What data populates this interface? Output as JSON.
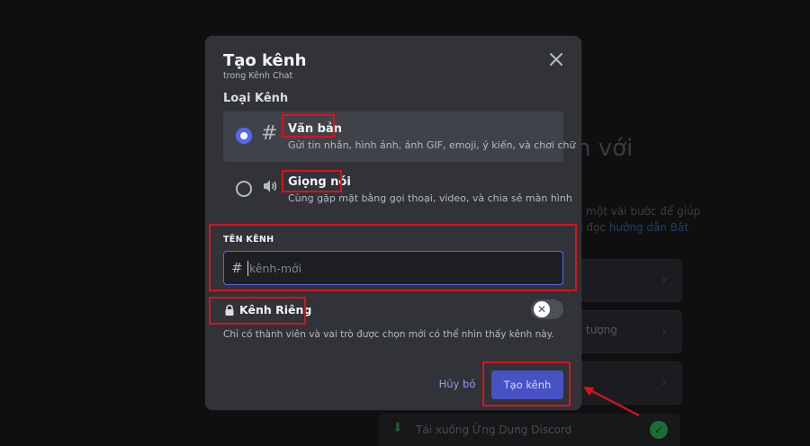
{
  "background": {
    "heading_fragment": "n với",
    "text_line1": "a một vài bước để giúp",
    "text_line2_prefix": "n đọc ",
    "text_line2_link": "hướng dẫn Bắt",
    "card_text": "tượng",
    "download_label": "Tải xuống Ứng Dụng Discord"
  },
  "modal": {
    "title": "Tạo kênh",
    "subtitle": "trong Kênh Chat",
    "channel_type_label": "Loại Kênh",
    "options": [
      {
        "title": "Văn bản",
        "description": "Gửi tin nhắn, hình ảnh, ảnh GIF, emoji, ý kiến, và chơi chữ",
        "icon": "hash-icon",
        "selected": true
      },
      {
        "title": "Giọng nói",
        "description": "Cùng gặp mặt bằng gọi thoại, video, và chia sẻ màn hình",
        "icon": "speaker-icon",
        "selected": false
      }
    ],
    "name_field": {
      "label": "TÊN KÊNH",
      "prefix": "#",
      "placeholder": "kênh-mới",
      "value": ""
    },
    "private": {
      "label": "Kênh Riêng",
      "description": "Chỉ có thành viên và vai trò được chọn mới có thể nhìn thấy kênh này.",
      "enabled": false
    },
    "buttons": {
      "cancel": "Hủy bỏ",
      "create": "Tạo kênh"
    }
  },
  "colors": {
    "modal_bg": "#313338",
    "accent": "#5865f2",
    "create_button": "#4752c4",
    "annotation": "#d9131b"
  }
}
